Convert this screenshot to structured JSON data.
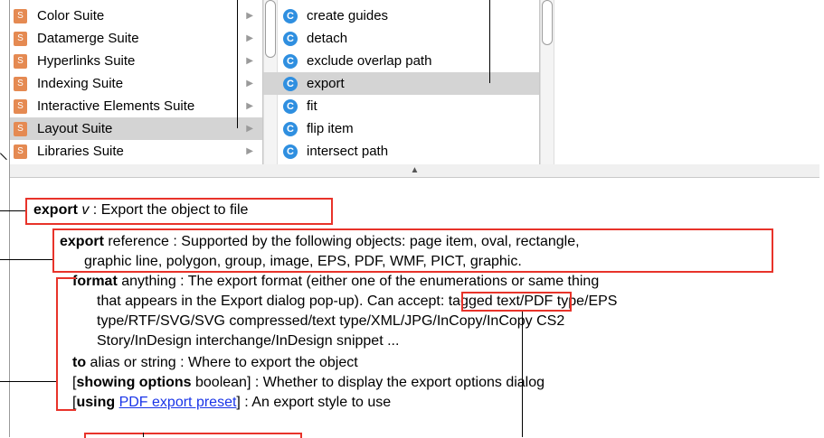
{
  "suites": [
    {
      "label": "Color Suite",
      "badge": "S"
    },
    {
      "label": "Datamerge Suite",
      "badge": "S"
    },
    {
      "label": "Hyperlinks Suite",
      "badge": "S"
    },
    {
      "label": "Indexing Suite",
      "badge": "S"
    },
    {
      "label": "Interactive Elements Suite",
      "badge": "S"
    },
    {
      "label": "Layout Suite",
      "badge": "S",
      "selected": true
    },
    {
      "label": "Libraries Suite",
      "badge": "S"
    }
  ],
  "commands": [
    {
      "label": "create guides",
      "badge": "C"
    },
    {
      "label": "detach",
      "badge": "C"
    },
    {
      "label": "exclude overlap path",
      "badge": "C"
    },
    {
      "label": "export",
      "badge": "C",
      "selected": true
    },
    {
      "label": "fit",
      "badge": "C"
    },
    {
      "label": "flip item",
      "badge": "C"
    },
    {
      "label": "intersect path",
      "badge": "C"
    }
  ],
  "doc": {
    "title_name": "export",
    "title_kind": "v",
    "title_desc": " : Export the object to file",
    "direct_name": "export",
    "direct_desc": " reference : Supported by the following objects: page item, oval, rectangle,",
    "direct_desc2": "graphic line, polygon, group, image, EPS, PDF, WMF, PICT, graphic.",
    "format_name": "format",
    "format_desc": " anything : The export format (either one of the enumerations or same thing",
    "format_desc2a": "that appears in the Export dialog pop-up).",
    "can_accept": "Can accept:",
    "format_desc2b": " tagged text/PDF type/EPS",
    "format_desc3": "type/RTF/SVG/SVG compressed/text type/XML/JPG/InCopy/InCopy CS2",
    "format_desc4": "Story/InDesign interchange/InDesign snippet ...",
    "to_name": "to",
    "to_desc": " alias or string : Where to export the object",
    "showing_open": "[",
    "showing_name": "showing options",
    "showing_desc": " boolean] : Whether to display the export options dialog",
    "using_open": "[",
    "using_name": "using",
    "using_space": " ",
    "using_link": "PDF export preset",
    "using_desc": "] : An export style to use"
  },
  "colors": {
    "annotation": "#e8332a",
    "link": "#1a35e8",
    "suite_badge": "#e58a52",
    "command_badge": "#2f8fe0"
  }
}
